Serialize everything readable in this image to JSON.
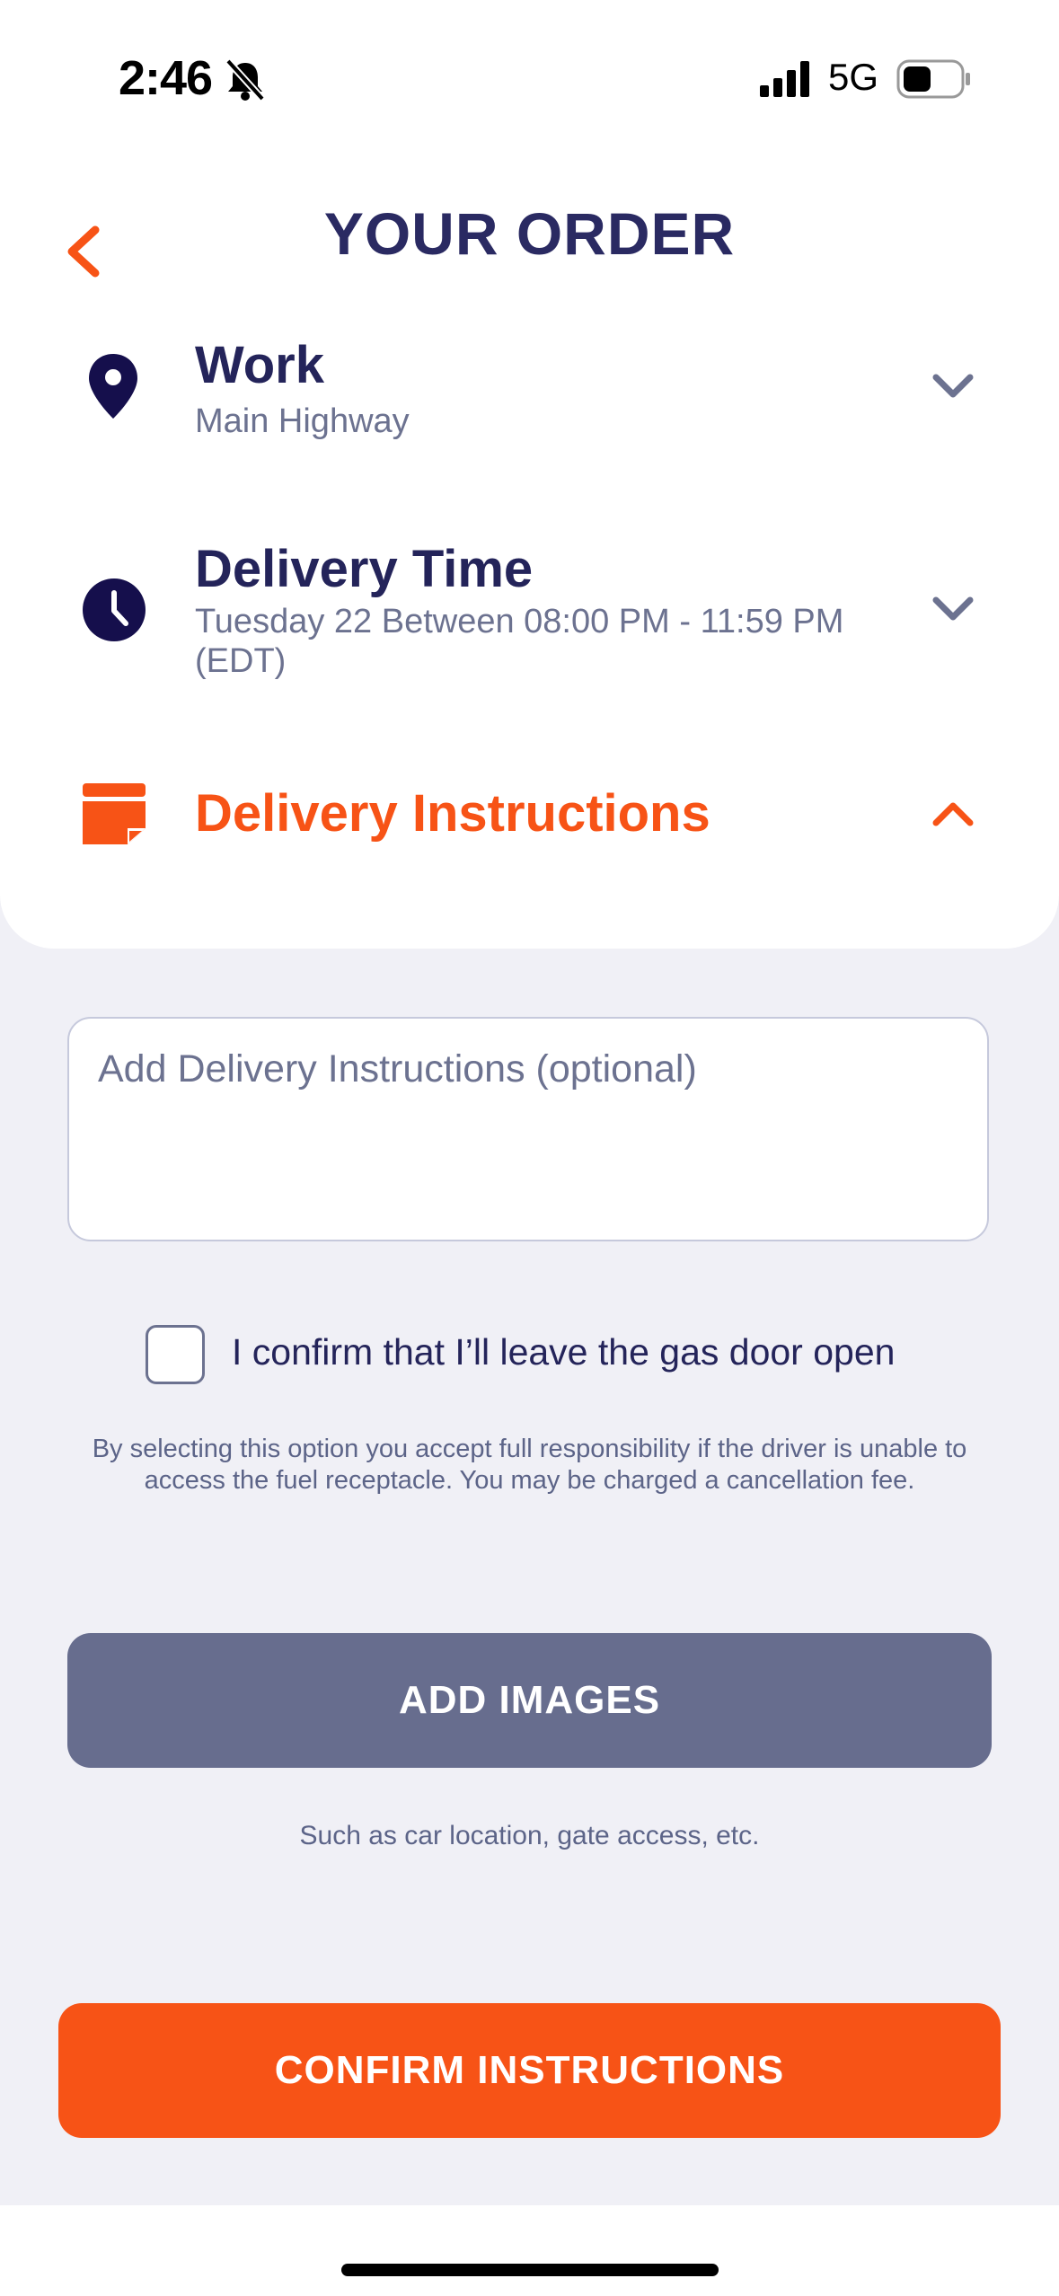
{
  "status_bar": {
    "time": "2:46",
    "network": "5G"
  },
  "header": {
    "title": "YOUR ORDER"
  },
  "location": {
    "title": "Work",
    "subtitle": "Main Highway"
  },
  "delivery_time": {
    "title": "Delivery Time",
    "subtitle_line1": "Tuesday 22 Between 08:00 PM - 11:59 PM",
    "subtitle_line2": "(EDT)"
  },
  "delivery_instructions": {
    "title": "Delivery Instructions"
  },
  "form": {
    "placeholder": "Add Delivery Instructions (optional)",
    "checkbox_label": "I confirm that I’ll leave the gas door open",
    "disclaimer_line1": "By selecting this option you accept full responsibility if the driver is unable to",
    "disclaimer_line2": "access the fuel receptacle. You may be charged a cancellation fee."
  },
  "actions": {
    "add_images": "ADD IMAGES",
    "add_images_hint": "Such as car location, gate access, etc.",
    "confirm": "CONFIRM INSTRUCTIONS"
  },
  "colors": {
    "accent": "#f75316",
    "navy": "#24245a",
    "muted": "#6c7290",
    "secondary_button": "#676d8e"
  },
  "icons": [
    "bell-slash-icon",
    "signal-icon",
    "battery-icon",
    "back-chevron-icon",
    "location-pin-icon",
    "clock-icon",
    "instructions-icon",
    "chevron-down-icon",
    "chevron-up-icon"
  ]
}
